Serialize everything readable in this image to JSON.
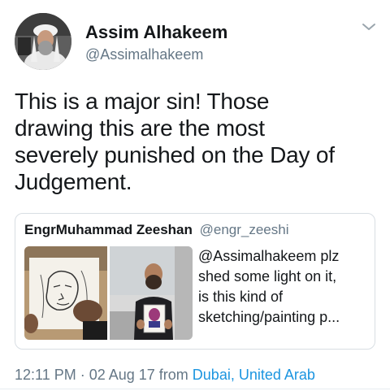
{
  "author": {
    "display_name": "Assim Alhakeem",
    "handle": "@Assimalhakeem"
  },
  "tweet": {
    "text_lines": [
      "This is a major sin! Those",
      "drawing this are the most",
      "severely punished on the Day of",
      "Judgement."
    ]
  },
  "quoted_tweet": {
    "author_name": "EngrMuhammad Zeeshan",
    "author_handle": "@engr_zeeshi",
    "text_lines": [
      "@Assimalhakeem plz",
      "shed some light on it,",
      "is this kind of",
      "sketching/painting p..."
    ],
    "media_icons": [
      "sketch-drawing-photo",
      "man-holding-portrait-photo"
    ]
  },
  "meta": {
    "time_date": "12:11 PM · 02 Aug 17 from ",
    "location": "Dubai, United Arab"
  },
  "icons": {
    "menu": "chevron-down-icon"
  },
  "colors": {
    "text": "#14171a",
    "secondary": "#657786",
    "link": "#1b95e0",
    "border": "#d8dee3"
  }
}
